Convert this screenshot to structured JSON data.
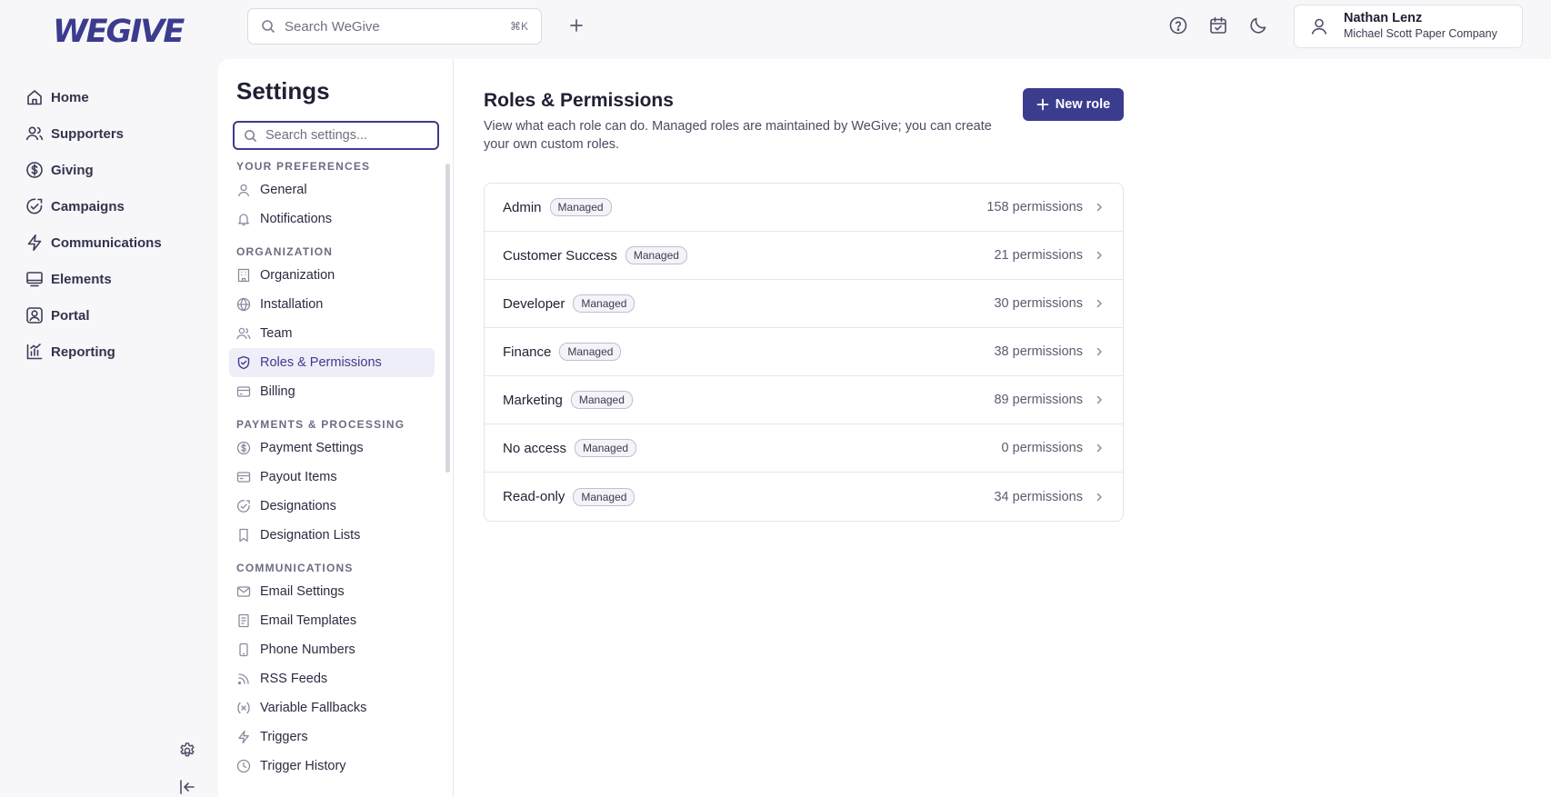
{
  "brand": {
    "logo_text": "WEGIVE",
    "accent": "#3b3c8e"
  },
  "topbar": {
    "search_placeholder": "Search WeGive",
    "search_shortcut": "⌘K",
    "add_icon": "plus-icon",
    "icons": [
      "help-circle-icon",
      "calendar-check-icon",
      "moon-icon"
    ],
    "user": {
      "name": "Nathan Lenz",
      "company": "Michael Scott Paper Company"
    }
  },
  "nav": {
    "items": [
      {
        "label": "Home",
        "icon": "home-icon"
      },
      {
        "label": "Supporters",
        "icon": "users-icon"
      },
      {
        "label": "Giving",
        "icon": "dollar-circle-icon"
      },
      {
        "label": "Campaigns",
        "icon": "campaign-icon"
      },
      {
        "label": "Communications",
        "icon": "lightning-icon"
      },
      {
        "label": "Elements",
        "icon": "monitor-icon"
      },
      {
        "label": "Portal",
        "icon": "portal-user-icon"
      },
      {
        "label": "Reporting",
        "icon": "chart-icon"
      }
    ]
  },
  "settings": {
    "title": "Settings",
    "search_placeholder": "Search settings...",
    "sections": [
      {
        "heading": "YOUR PREFERENCES",
        "items": [
          {
            "label": "General",
            "icon": "user-icon"
          },
          {
            "label": "Notifications",
            "icon": "bell-icon"
          }
        ]
      },
      {
        "heading": "ORGANIZATION",
        "items": [
          {
            "label": "Organization",
            "icon": "building-icon"
          },
          {
            "label": "Installation",
            "icon": "globe-icon"
          },
          {
            "label": "Team",
            "icon": "users-icon"
          },
          {
            "label": "Roles & Permissions",
            "icon": "shield-check-icon",
            "active": true
          },
          {
            "label": "Billing",
            "icon": "credit-card-icon"
          }
        ]
      },
      {
        "heading": "PAYMENTS & PROCESSING",
        "items": [
          {
            "label": "Payment Settings",
            "icon": "dollar-circle-icon"
          },
          {
            "label": "Payout Items",
            "icon": "payout-icon"
          },
          {
            "label": "Designations",
            "icon": "designation-icon"
          },
          {
            "label": "Designation Lists",
            "icon": "bookmark-icon"
          }
        ]
      },
      {
        "heading": "COMMUNICATIONS",
        "items": [
          {
            "label": "Email Settings",
            "icon": "mail-icon"
          },
          {
            "label": "Email Templates",
            "icon": "document-icon"
          },
          {
            "label": "Phone Numbers",
            "icon": "phone-icon"
          },
          {
            "label": "RSS Feeds",
            "icon": "rss-icon"
          },
          {
            "label": "Variable Fallbacks",
            "icon": "variable-icon"
          },
          {
            "label": "Triggers",
            "icon": "lightning-icon"
          },
          {
            "label": "Trigger History",
            "icon": "clock-icon"
          }
        ]
      }
    ]
  },
  "main": {
    "title": "Roles & Permissions",
    "description": "View what each role can do. Managed roles are maintained by WeGive; you can create your own custom roles.",
    "new_role_label": "New role",
    "roles": [
      {
        "name": "Admin",
        "badge": "Managed",
        "permissions": "158 permissions"
      },
      {
        "name": "Customer Success",
        "badge": "Managed",
        "permissions": "21 permissions"
      },
      {
        "name": "Developer",
        "badge": "Managed",
        "permissions": "30 permissions"
      },
      {
        "name": "Finance",
        "badge": "Managed",
        "permissions": "38 permissions"
      },
      {
        "name": "Marketing",
        "badge": "Managed",
        "permissions": "89 permissions"
      },
      {
        "name": "No access",
        "badge": "Managed",
        "permissions": "0 permissions"
      },
      {
        "name": "Read-only",
        "badge": "Managed",
        "permissions": "34 permissions"
      }
    ]
  }
}
